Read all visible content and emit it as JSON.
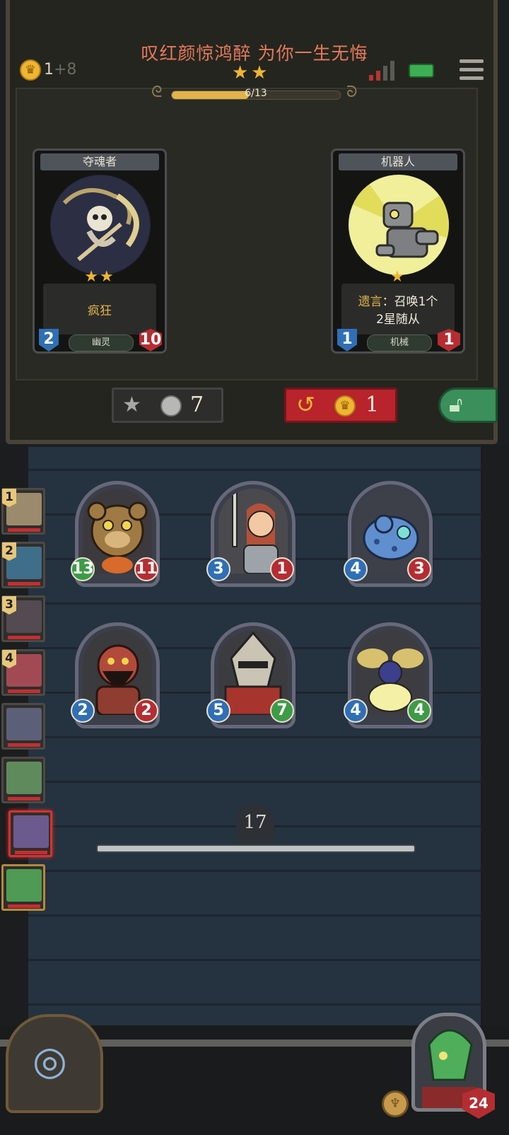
{
  "header": {
    "title": "叹红颜惊鸿醉 为你一生无悔",
    "stars": "★★",
    "progress_text": "6/13",
    "progress": 0.46,
    "gold": "1",
    "gold_gain": "+8"
  },
  "shop": {
    "cards": [
      {
        "name": "夺魂者",
        "stars": "★★",
        "desc_line1": "疯狂",
        "desc_line2": "",
        "attack": "2",
        "health": "10",
        "tribe": "幽灵"
      },
      {
        "name": "机器人",
        "stars": "★",
        "desc_keyword": "遗言",
        "desc_line1": "：召唤1个",
        "desc_line2": "2星随从",
        "attack": "1",
        "health": "1",
        "tribe": "机械"
      }
    ],
    "upgrade_cost": "7",
    "refresh_cost": "1"
  },
  "board": {
    "minions": [
      {
        "name": "bear",
        "attack": "13",
        "health": "11",
        "atk_buffed": true,
        "hp_buffed": false
      },
      {
        "name": "knight-girl",
        "attack": "3",
        "health": "1",
        "atk_buffed": false,
        "hp_buffed": false
      },
      {
        "name": "frog",
        "attack": "4",
        "health": "3",
        "atk_buffed": false,
        "hp_buffed": false
      },
      {
        "name": "ogre",
        "attack": "2",
        "health": "2",
        "atk_buffed": false,
        "hp_buffed": false
      },
      {
        "name": "armored-warrior",
        "attack": "5",
        "health": "7",
        "atk_buffed": false,
        "hp_buffed": true
      },
      {
        "name": "firefly",
        "attack": "4",
        "health": "4",
        "atk_buffed": false,
        "hp_buffed": true
      }
    ],
    "timer": "17"
  },
  "ranking": [
    "1",
    "2",
    "3",
    "4"
  ],
  "hero": {
    "health": "24"
  },
  "colors": {
    "gold": "#f0b531",
    "health": "#b52d32",
    "attack": "#2f6fb6",
    "buff": "#3d9b45"
  }
}
